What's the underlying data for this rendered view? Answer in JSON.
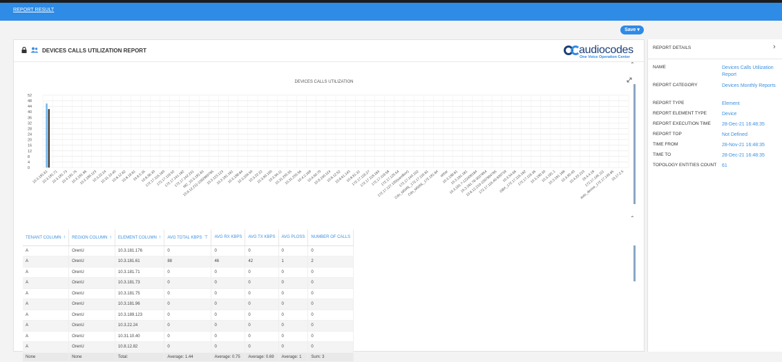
{
  "topbar": {
    "tab_label": "REPORT RESULT"
  },
  "toolbar": {
    "save_label": "Save ▾"
  },
  "report": {
    "title": "DEVICES CALLS UTILIZATION REPORT",
    "logo_text": "audiocodes",
    "logo_sub": "One Voice Operation Center"
  },
  "chart_data": {
    "type": "bar",
    "title": "DEVICES CALLS UTILIZATION",
    "ylim": [
      0,
      52
    ],
    "yticks": [
      0,
      4,
      8,
      12,
      16,
      20,
      24,
      28,
      32,
      36,
      40,
      44,
      48,
      52
    ],
    "categories": [
      "10.3.181.61",
      "10.3.181.71",
      "10.3.181.73",
      "10.3.181.75",
      "10.3.181.96",
      "10.3.189.123",
      "10.3.22.24",
      "10.31.10.40",
      "10.8.12.82",
      "10.8.18.81",
      "10.8.5.35",
      "10.8.96.30",
      "172.17.116.160",
      "172.17.116.52",
      "172.17.141.182",
      "172.17.142.231",
      "MC_10.3.181.83",
      "10.8.12.211-1092969785",
      "10.3.123.123",
      "10.3.181.181",
      "10.3.188.84",
      "10.3.204.50",
      "10.3.22.22",
      "10.3.90.100",
      "10.3.94.11",
      "10.31.255.55",
      "10.31.255.56",
      "10.4.2.169",
      "10.4.60.70",
      "10.8.100.124",
      "10.8.12.52",
      "10.8.61.143",
      "10.8.61.31",
      "172.17.116.27",
      "172.17.118.183",
      "172.17.118.58",
      "172.17.125.54",
      "172.17.127.100(sandbox)",
      "172.17.140.102",
      "Cdn_M500L_172.17.116.81",
      "Cdn_M500L_172.181.84",
      "sbbar",
      "10.3.188.81",
      "10.3.181.181",
      "10.3.181.7-122406184",
      "10.3.181.78-3037854",
      "10.8.12.210-1097994785",
      "172.17.116.40-939739",
      "10.3.54.66",
      "GBX_172.17.116.182",
      "172.17.116.36",
      "10.3.180.30",
      "10.3.181.1",
      "10.3.181.188",
      "10.3.90.40",
      "10.4.20.210",
      "10.4.4.18",
      "172.17.145.111",
      "auto_device_172.17.145.85",
      "10.17.2.5"
    ],
    "series": [
      {
        "values": [
          46,
          0,
          0,
          0,
          0,
          0,
          0,
          0,
          0,
          0,
          0,
          0,
          0,
          0,
          0,
          0,
          0,
          0,
          0,
          0,
          0,
          0,
          0,
          0,
          0,
          0,
          0,
          0,
          0,
          0,
          0,
          0,
          0,
          0,
          0,
          0,
          0,
          0,
          0,
          0,
          0,
          0,
          0,
          0,
          0,
          0,
          0,
          0,
          0,
          0,
          0,
          0,
          0,
          0,
          0,
          0,
          0,
          0,
          0,
          0
        ]
      },
      {
        "values": [
          42,
          0,
          0,
          0,
          0,
          0,
          0,
          0,
          0,
          0,
          0,
          0,
          0,
          0,
          0,
          0,
          0,
          0,
          0,
          0,
          0,
          0,
          0,
          0,
          0,
          0,
          0,
          0,
          0,
          0,
          0,
          0,
          0,
          0,
          0,
          0,
          0,
          0,
          0,
          0,
          0,
          0,
          0,
          0,
          0,
          0,
          0,
          0,
          0,
          0,
          0,
          0,
          0,
          0,
          0,
          0,
          0,
          0,
          0,
          0
        ]
      }
    ],
    "series_colors": [
      "#6fb5ea",
      "#3a3a3a"
    ],
    "grid": true
  },
  "table": {
    "columns": [
      {
        "label": "TENANT COLUMN",
        "sort": "↑"
      },
      {
        "label": "REGION COLUMN",
        "sort": "↑"
      },
      {
        "label": "ELEMENT COLUMN",
        "sort": "↑"
      },
      {
        "label": "AVG TOTAL KBPS",
        "sort": "⊤"
      },
      {
        "label": "AVG RX KBPS",
        "sort": ""
      },
      {
        "label": "AVG TX KBPS",
        "sort": ""
      },
      {
        "label": "AVG PLOSS",
        "sort": ""
      },
      {
        "label": "NUMBER OF CALLS",
        "sort": ""
      }
    ],
    "rows": [
      [
        "A",
        "OrenU",
        "10.3.181.176",
        "0",
        "0",
        "0",
        "0",
        "0"
      ],
      [
        "A",
        "OrenU",
        "10.3.181.61",
        "88",
        "46",
        "42",
        "1",
        "2"
      ],
      [
        "A",
        "OrenU",
        "10.3.181.71",
        "0",
        "0",
        "0",
        "0",
        "0"
      ],
      [
        "A",
        "OrenU",
        "10.3.181.73",
        "0",
        "0",
        "0",
        "0",
        "0"
      ],
      [
        "A",
        "OrenU",
        "10.3.181.75",
        "0",
        "0",
        "0",
        "0",
        "0"
      ],
      [
        "A",
        "OrenU",
        "10.3.181.96",
        "0",
        "0",
        "0",
        "0",
        "0"
      ],
      [
        "A",
        "OrenU",
        "10.3.189.123",
        "0",
        "0",
        "0",
        "0",
        "0"
      ],
      [
        "A",
        "OrenU",
        "10.3.22.24",
        "0",
        "0",
        "0",
        "0",
        "0"
      ],
      [
        "A",
        "OrenU",
        "10.31.10.40",
        "0",
        "0",
        "0",
        "0",
        "0"
      ],
      [
        "A",
        "OrenU",
        "10.8.12.82",
        "0",
        "0",
        "0",
        "0",
        "0"
      ]
    ],
    "footer": [
      "None",
      "None",
      "Total:",
      "Average: 1.44",
      "Average: 0.75",
      "Average: 0.69",
      "Average: 1",
      "Sum: 3"
    ]
  },
  "details": {
    "header": "REPORT DETAILS",
    "items": [
      {
        "label": "NAME",
        "value": "Devices Calls Utilization Report"
      },
      {
        "label": "REPORT CATEGORY",
        "value": "Devices Monthly Reports"
      },
      {
        "label": "REPORT TYPE",
        "value": "Element"
      },
      {
        "label": "REPORT ELEMENT TYPE",
        "value": "Device"
      },
      {
        "label": "REPORT EXECUTION TIME",
        "value": "28-Dec-21 16:48:35"
      },
      {
        "label": "REPORT TOP",
        "value": "Not Defined"
      },
      {
        "label": "TIME FROM",
        "value": "28-Nov-21 16:48:35"
      },
      {
        "label": "TIME TO",
        "value": "28-Dec-21 16:48:35"
      },
      {
        "label": "TOPOLOGY ENTITIES COUNT",
        "value": "61"
      }
    ]
  }
}
